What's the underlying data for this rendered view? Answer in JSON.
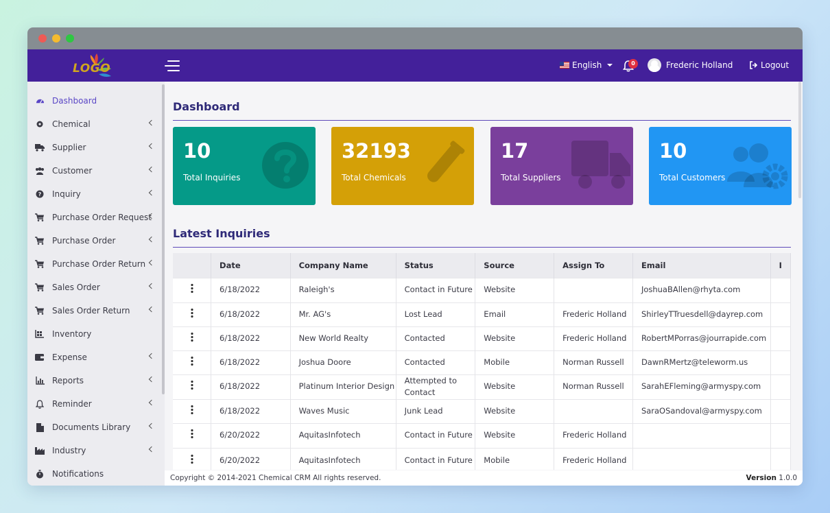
{
  "window": {
    "title_dots": [
      "close",
      "minimize",
      "maximize"
    ]
  },
  "topbar": {
    "logo_text": "LOGO",
    "language": "English",
    "notification_count": "0",
    "user_name": "Frederic Holland",
    "logout_label": "Logout"
  },
  "sidebar": {
    "items": [
      {
        "label": "Dashboard",
        "icon": "dashboard-icon",
        "active": true,
        "chevron": false
      },
      {
        "label": "Chemical",
        "icon": "flask-icon",
        "chevron": true
      },
      {
        "label": "Supplier",
        "icon": "truck-icon",
        "chevron": true
      },
      {
        "label": "Customer",
        "icon": "users-icon",
        "chevron": true
      },
      {
        "label": "Inquiry",
        "icon": "question-icon",
        "chevron": true
      },
      {
        "label": "Purchase Order Request",
        "icon": "cart-icon",
        "chevron": true
      },
      {
        "label": "Purchase Order",
        "icon": "cart-icon",
        "chevron": true
      },
      {
        "label": "Purchase Order Return",
        "icon": "cart-icon",
        "chevron": true
      },
      {
        "label": "Sales Order",
        "icon": "cart-icon",
        "chevron": true
      },
      {
        "label": "Sales Order Return",
        "icon": "cart-icon",
        "chevron": true
      },
      {
        "label": "Inventory",
        "icon": "inventory-icon",
        "chevron": false
      },
      {
        "label": "Expense",
        "icon": "wallet-icon",
        "chevron": true
      },
      {
        "label": "Reports",
        "icon": "chart-icon",
        "chevron": true
      },
      {
        "label": "Reminder",
        "icon": "bell-icon",
        "chevron": true
      },
      {
        "label": "Documents Library",
        "icon": "document-icon",
        "chevron": true
      },
      {
        "label": "Industry",
        "icon": "industry-icon",
        "chevron": true
      },
      {
        "label": "Notifications",
        "icon": "stopwatch-icon",
        "chevron": false
      }
    ]
  },
  "main": {
    "title": "Dashboard",
    "cards": [
      {
        "value": "10",
        "label": "Total Inquiries",
        "color": "#059a88",
        "icon": "question-circle-icon"
      },
      {
        "value": "32193",
        "label": "Total Chemicals",
        "color": "#d4a007",
        "icon": "test-tube-icon"
      },
      {
        "value": "17",
        "label": "Total Suppliers",
        "color": "#7a3f9c",
        "icon": "truck-icon"
      },
      {
        "value": "10",
        "label": "Total Customers",
        "color": "#2196f3",
        "icon": "users-gear-icon"
      }
    ],
    "latest_title": "Latest Inquiries",
    "table": {
      "headers": [
        "",
        "Date",
        "Company Name",
        "Status",
        "Source",
        "Assign To",
        "Email",
        "I"
      ],
      "rows": [
        [
          "6/18/2022",
          "Raleigh's",
          "Contact in Future",
          "Website",
          "",
          "JoshuaBAllen@rhyta.com"
        ],
        [
          "6/18/2022",
          "Mr. AG's",
          "Lost Lead",
          "Email",
          "Frederic Holland",
          "ShirleyTTruesdell@dayrep.com"
        ],
        [
          "6/18/2022",
          "New World Realty",
          "Contacted",
          "Website",
          "Frederic Holland",
          "RobertMPorras@jourrapide.com"
        ],
        [
          "6/18/2022",
          "Joshua Doore",
          "Contacted",
          "Mobile",
          "Norman Russell",
          "DawnRMertz@teleworm.us"
        ],
        [
          "6/18/2022",
          "Platinum Interior Design",
          "Attempted to Contact",
          "Website",
          "Norman Russell",
          "SarahEFleming@armyspy.com"
        ],
        [
          "6/18/2022",
          "Waves Music",
          "Junk Lead",
          "Website",
          "",
          "SaraOSandoval@armyspy.com"
        ],
        [
          "6/20/2022",
          "AquitasInfotech",
          "Contact in Future",
          "Website",
          "Frederic Holland",
          ""
        ],
        [
          "6/20/2022",
          "AquitasInfotech",
          "Contact in Future",
          "Mobile",
          "Frederic Holland",
          ""
        ]
      ]
    }
  },
  "footer": {
    "copyright": "Copyright © 2014-2021 Chemical CRM All rights reserved.",
    "version_label": "Version",
    "version_value": "1.0.0"
  }
}
